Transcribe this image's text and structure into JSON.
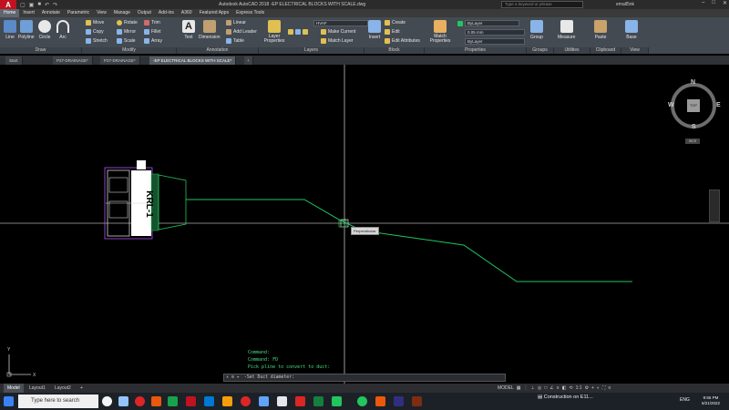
{
  "titlebar": {
    "logo": "A",
    "title": "Autodesk AutoCAD 2018  -EP ELECTRICAL BLOCKS WITH SCALE.dwg",
    "search_placeholder": "Type a keyword or phrase",
    "user": "emall5nk"
  },
  "ribbon_tabs": [
    "Home",
    "Insert",
    "Annotate",
    "Parametric",
    "View",
    "Manage",
    "Output",
    "Add-ins",
    "A360",
    "Featured Apps",
    "Express Tools"
  ],
  "ribbon": {
    "draw": {
      "line": "Line",
      "polyline": "Polyline",
      "circle": "Circle",
      "arc": "Arc",
      "panel": "Draw"
    },
    "modify": {
      "move": "Move",
      "rotate": "Rotate",
      "trim": "Trim",
      "copy": "Copy",
      "mirror": "Mirror",
      "fillet": "Fillet",
      "stretch": "Stretch",
      "scale": "Scale",
      "array": "Array",
      "panel": "Modify"
    },
    "annotation": {
      "text": "Text",
      "dimension": "Dimension",
      "linear": "Linear",
      "leader": "Add Leader",
      "table": "Table",
      "panel": "Annotation"
    },
    "layers": {
      "layer_props": "Layer Properties",
      "current_layer": "HVAF",
      "make_current": "Make Current",
      "match_layer": "Match Layer",
      "panel": "Layers"
    },
    "block": {
      "insert": "Insert",
      "create": "Create",
      "edit": "Edit",
      "edit_attr": "Edit Attributes",
      "panel": "Block"
    },
    "properties": {
      "match": "Match Properties",
      "color": "ByLayer",
      "lineweight": "0.05 mm",
      "linetype": "ByLayer",
      "panel": "Properties"
    },
    "groups": {
      "group": "Group",
      "panel": "Groups"
    },
    "utilities": {
      "measure": "Measure",
      "panel": "Utilities"
    },
    "clipboard": {
      "paste": "Paste",
      "panel": "Clipboard"
    },
    "view": {
      "base": "Base",
      "panel": "View"
    }
  },
  "doc_tabs": [
    "Start",
    "P27-DRAINAGE*",
    "P27-DRAINAGE*",
    "-EP ELECTRICAL BLOCKS WITH SCALE*"
  ],
  "drawing": {
    "block_label": "KRL-1",
    "tooltip": "Perpendicular"
  },
  "viewcube": {
    "top": "TOP",
    "n": "N",
    "s": "S",
    "e": "E",
    "w": "W",
    "wcs": "WCS"
  },
  "ucs": {
    "x": "X",
    "y": "Y"
  },
  "command": {
    "history": [
      "Command:",
      "Command: FD",
      "Pick pline to convert to duct:"
    ],
    "prompt": "-Set Duct diameter:"
  },
  "layout_tabs": [
    "Model",
    "Layout1",
    "Layout2"
  ],
  "status": {
    "model": "MODEL",
    "scale": "1:1"
  },
  "taskbar": {
    "search": "Type here to search",
    "notification": "Construction on E11...",
    "lang": "ENG",
    "time": "9:56 PM",
    "date": "6/21/2022"
  },
  "colors": {
    "accent": "#c1121f",
    "ribbon": "#434a52",
    "canvas": "#000000",
    "geometry": "#22c55e",
    "command": "#4ade80"
  }
}
